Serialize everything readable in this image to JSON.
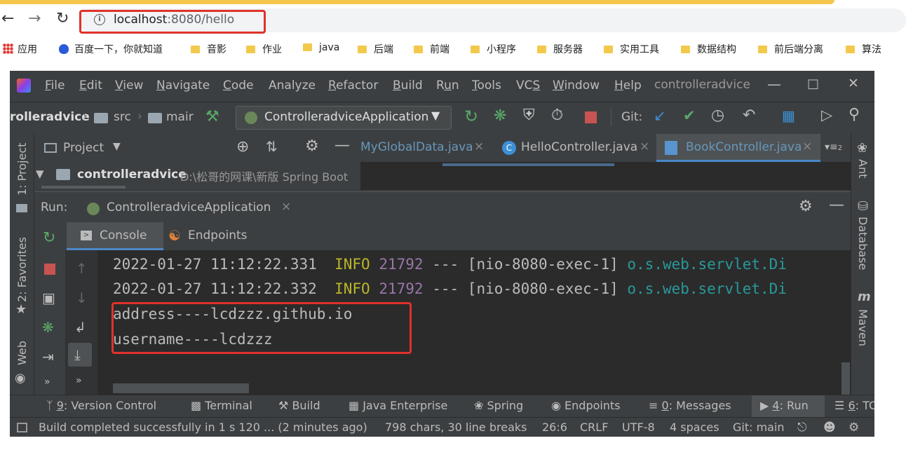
{
  "browser": {
    "url_host": "localhost",
    "url_rest": ":8080/hello",
    "bookmarks": [
      {
        "label": "应用",
        "icon": "apps-grid-icon"
      },
      {
        "label": "百度一下，你就知道",
        "icon": "baidu-paw-icon"
      },
      {
        "label": "音影",
        "icon": "folder-icon"
      },
      {
        "label": "作业",
        "icon": "folder-icon"
      },
      {
        "label": "java",
        "icon": "folder-icon"
      },
      {
        "label": "后端",
        "icon": "folder-icon"
      },
      {
        "label": "前端",
        "icon": "folder-icon"
      },
      {
        "label": "小程序",
        "icon": "folder-icon"
      },
      {
        "label": "服务器",
        "icon": "folder-icon"
      },
      {
        "label": "实用工具",
        "icon": "folder-icon"
      },
      {
        "label": "数据结构",
        "icon": "folder-icon"
      },
      {
        "label": "前后端分离",
        "icon": "folder-icon"
      },
      {
        "label": "算法",
        "icon": "folder-icon"
      }
    ]
  },
  "ide": {
    "menu": [
      "File",
      "Edit",
      "View",
      "Navigate",
      "Code",
      "Analyze",
      "Refactor",
      "Build",
      "Run",
      "Tools",
      "VCS",
      "Window",
      "Help"
    ],
    "window_title": "controlleradvice",
    "breadcrumb": {
      "project": "rolleradvice",
      "src": "src",
      "main": "mair"
    },
    "run_config": "ControlleradviceApplication",
    "git_label": "Git:",
    "left_tools": {
      "project": "1: Project",
      "favorites": "2: Favorites",
      "web": "Web"
    },
    "right_tools": {
      "ant": "Ant",
      "database": "Database",
      "maven": "Maven"
    },
    "project_panel": {
      "title": "Project",
      "root_name": "controlleradvice",
      "root_path": "D:\\松哥的网课\\新版 Spring Boot"
    },
    "editor_tabs": [
      {
        "label": "MyGlobalData.java",
        "active": false
      },
      {
        "label": "HelloController.java",
        "active": false
      },
      {
        "label": "BookController.java",
        "active": true
      }
    ],
    "tabs_overflow": "2",
    "run_panel": {
      "label": "Run:",
      "config": "ControlleradviceApplication",
      "console_tab": "Console",
      "endpoints_tab": "Endpoints"
    },
    "console_lines": [
      {
        "ts": "2022-01-27 11:12:22.331",
        "level": "INFO",
        "pid": "21792",
        "sep": "---",
        "thread": "[nio-8080-exec-1]",
        "logger": "o.s.web.servlet.Di"
      },
      {
        "ts": "2022-01-27 11:12:22.332",
        "level": "INFO",
        "pid": "21792",
        "sep": "---",
        "thread": "[nio-8080-exec-1]",
        "logger": "o.s.web.servlet.Di"
      }
    ],
    "console_output": [
      "address----lcdzzz.github.io",
      "username----lcdzzz"
    ],
    "bottom_tools": [
      {
        "mnemonic": "9",
        "rest": ": Version Control"
      },
      {
        "mnemonic": "",
        "rest": "Terminal"
      },
      {
        "mnemonic": "",
        "rest": "Build"
      },
      {
        "mnemonic": "",
        "rest": "Java Enterprise"
      },
      {
        "mnemonic": "",
        "rest": "Spring"
      },
      {
        "mnemonic": "",
        "rest": "Endpoints"
      },
      {
        "mnemonic": "0",
        "rest": ": Messages"
      },
      {
        "mnemonic": "4",
        "rest": ": Run"
      },
      {
        "mnemonic": "6",
        "rest": ": TC"
      }
    ],
    "status": {
      "message": "Build completed successfully in 1 s 120 ... (2 minutes ago)",
      "chars": "798 chars, 30 line breaks",
      "position": "26:6",
      "line_sep": "CRLF",
      "encoding": "UTF-8",
      "indent": "4 spaces",
      "git_branch": "Git: main"
    }
  }
}
